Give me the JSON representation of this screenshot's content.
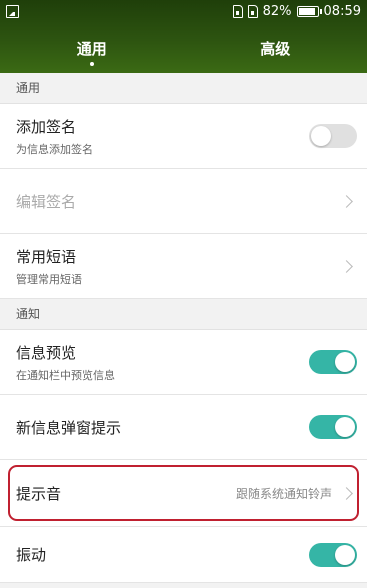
{
  "status": {
    "battery": "82%",
    "time": "08:59"
  },
  "tabs": [
    {
      "label": "通用"
    },
    {
      "label": "高级"
    }
  ],
  "sections": {
    "general": "通用",
    "notify": "通知"
  },
  "rows": {
    "add_signature": {
      "title": "添加签名",
      "sub": "为信息添加签名",
      "on": false
    },
    "edit_signature": {
      "title": "编辑签名"
    },
    "phrases": {
      "title": "常用短语",
      "sub": "管理常用短语"
    },
    "preview": {
      "title": "信息预览",
      "sub": "在通知栏中预览信息",
      "on": true
    },
    "popup": {
      "title": "新信息弹窗提示",
      "on": true
    },
    "sound": {
      "title": "提示音",
      "value": "跟随系统通知铃声"
    },
    "vibrate": {
      "title": "振动",
      "on": true
    }
  },
  "colors": {
    "accent": "#35b5a6",
    "header": "#2d5410",
    "highlight": "#c02030"
  }
}
